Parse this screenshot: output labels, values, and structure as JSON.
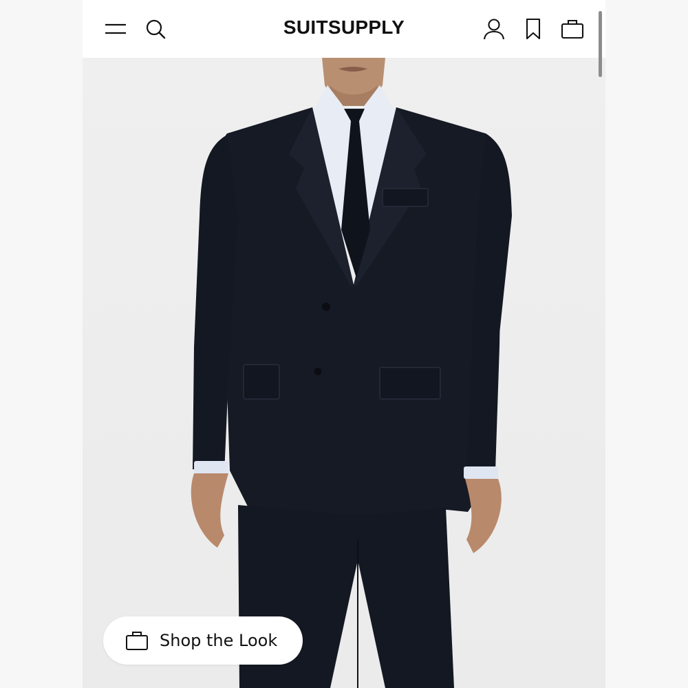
{
  "header": {
    "brand": "SUITSUPPLY",
    "icons": {
      "menu": "hamburger-menu-icon",
      "search": "search-icon",
      "account": "user-icon",
      "wishlist": "bookmark-icon",
      "bag": "shopping-bag-icon"
    }
  },
  "hero": {
    "cta_label": "Shop the Look",
    "cta_icon": "shopping-bag-icon"
  },
  "colors": {
    "header_bg": "#ffffff",
    "page_bg": "#eeeeee",
    "suit": "#161a24",
    "text": "#111111"
  }
}
